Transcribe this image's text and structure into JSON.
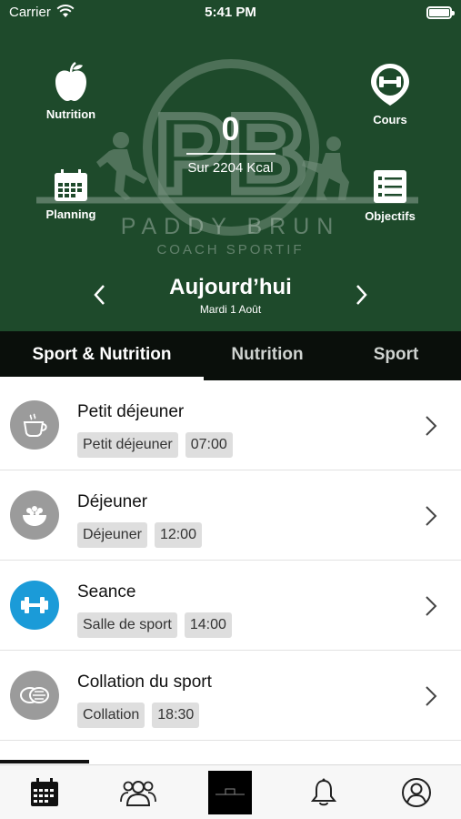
{
  "status_bar": {
    "carrier": "Carrier",
    "time": "5:41 PM"
  },
  "brand": {
    "name": "PADDY BRUN",
    "subtitle": "COACH SPORTIF"
  },
  "calories": {
    "value": "0",
    "total_label": "Sur 2204 Kcal"
  },
  "quick_actions": {
    "nutrition": {
      "label": "Nutrition",
      "icon": "apple-icon"
    },
    "cours": {
      "label": "Cours",
      "icon": "dumbbell-pin-icon"
    },
    "planning": {
      "label": "Planning",
      "icon": "calendar-icon"
    },
    "objectifs": {
      "label": "Objectifs",
      "icon": "checklist-icon"
    }
  },
  "day": {
    "title": "Aujourd’hui",
    "date": "Mardi 1 Août"
  },
  "tabs": [
    {
      "label": "Sport & Nutrition",
      "active": true
    },
    {
      "label": "Nutrition",
      "active": false
    },
    {
      "label": "Sport",
      "active": false
    }
  ],
  "entries": [
    {
      "name": "Petit déjeuner",
      "category": "Petit déjeuner",
      "time": "07:00",
      "icon": "coffee-cup-icon"
    },
    {
      "name": "Déjeuner",
      "category": "Déjeuner",
      "time": "12:00",
      "icon": "salad-bowl-icon"
    },
    {
      "name": "Seance",
      "category": "Salle de sport",
      "time": "14:00",
      "icon": "dumbbell-icon"
    },
    {
      "name": "Collation du sport",
      "category": "Collation",
      "time": "18:30",
      "icon": "snack-icon"
    }
  ],
  "tabbar": {
    "items": [
      "calendar-icon",
      "people-icon",
      "brand-logo",
      "bell-icon",
      "profile-icon"
    ]
  },
  "colors": {
    "header_bg": "#1e4a2b",
    "tabs_bg": "#0a0f0b",
    "accent_blue": "#1b9bd8",
    "icon_grey": "#9b9b9b",
    "chip_bg": "#dedede"
  }
}
